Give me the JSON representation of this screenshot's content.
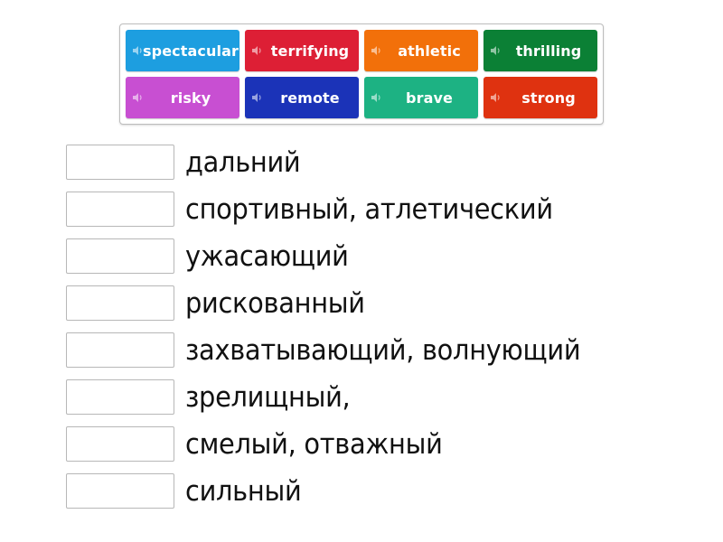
{
  "tiles": [
    {
      "word": "spectacular",
      "color": "#1d9ee0",
      "icon": "speaker-icon"
    },
    {
      "word": "terrifying",
      "color": "#dd1f35",
      "icon": "speaker-icon"
    },
    {
      "word": "athletic",
      "color": "#f2700a",
      "icon": "speaker-icon"
    },
    {
      "word": "thrilling",
      "color": "#0b8035",
      "icon": "speaker-icon"
    },
    {
      "word": "risky",
      "color": "#c84fd2",
      "icon": "speaker-icon"
    },
    {
      "word": "remote",
      "color": "#1b33b8",
      "icon": "speaker-icon"
    },
    {
      "word": "brave",
      "color": "#1db283",
      "icon": "speaker-icon"
    },
    {
      "word": "strong",
      "color": "#df3210",
      "icon": "speaker-icon"
    }
  ],
  "definitions": [
    "дальний",
    "спортивный, атлетический",
    "ужасающий",
    "рискованный",
    "захватывающий, волнующий",
    "зрелищный,",
    "смелый, отважный",
    "сильный"
  ]
}
